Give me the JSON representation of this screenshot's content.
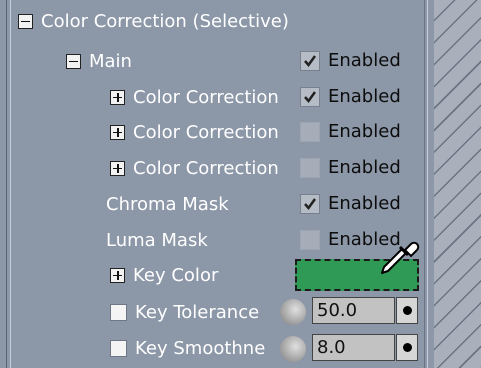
{
  "root": {
    "label": "Color Correction (Selective)"
  },
  "main": {
    "label": "Main"
  },
  "rows": {
    "cc1": {
      "label": "Color Correction",
      "enabled_label": "Enabled",
      "checked": true
    },
    "cc2": {
      "label": "Color Correction",
      "enabled_label": "Enabled",
      "checked": false
    },
    "cc3": {
      "label": "Color Correction",
      "enabled_label": "Enabled",
      "checked": false
    },
    "chroma": {
      "label": "Chroma Mask",
      "enabled_label": "Enabled",
      "checked": true
    },
    "luma": {
      "label": "Luma Mask",
      "enabled_label": "Enabled",
      "checked": false
    },
    "main_enabled": {
      "enabled_label": "Enabled",
      "checked": true
    }
  },
  "key_color": {
    "label": "Key Color",
    "color": "#2f9a55"
  },
  "key_tolerance": {
    "label": "Key Tolerance",
    "value": "50.0"
  },
  "key_smoothness": {
    "label": "Key Smoothne",
    "value": "8.0"
  },
  "icons": {
    "eyedropper": "eyedropper-icon",
    "check": "checkmark-icon",
    "expand": "plus-box-icon",
    "collapse": "minus-box-icon"
  }
}
